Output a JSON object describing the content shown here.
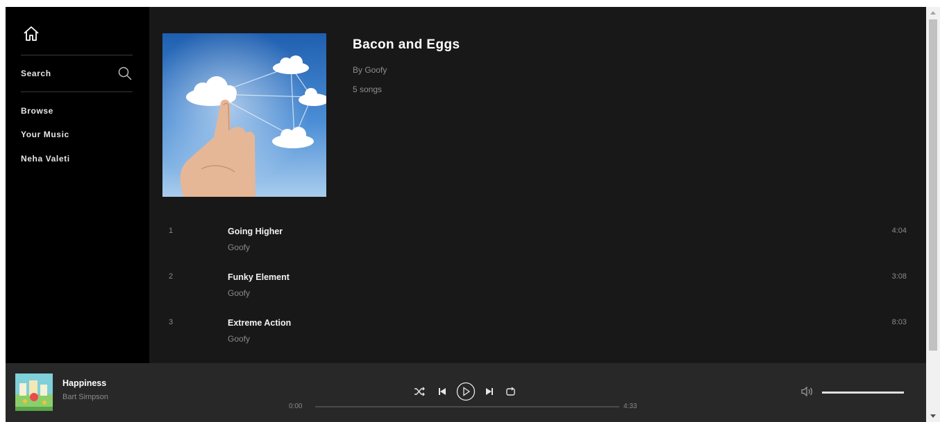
{
  "sidebar": {
    "search_label": "Search",
    "items": [
      {
        "label": "Browse"
      },
      {
        "label": "Your Music"
      },
      {
        "label": "Neha Valeti"
      }
    ]
  },
  "album": {
    "title": "Bacon and Eggs",
    "artist": "By Goofy",
    "song_count": "5 songs",
    "art_icon": "cloud-touch-artwork"
  },
  "tracks": [
    {
      "num": "1",
      "title": "Going Higher",
      "artist": "Goofy",
      "duration": "4:04"
    },
    {
      "num": "2",
      "title": "Funky Element",
      "artist": "Goofy",
      "duration": "3:08"
    },
    {
      "num": "3",
      "title": "Extreme Action",
      "artist": "Goofy",
      "duration": "8:03"
    }
  ],
  "player": {
    "now_title": "Happiness",
    "now_artist": "Bart Simpson",
    "time_current": "0:00",
    "time_total": "4:33",
    "progress": 0,
    "volume": 1.0
  },
  "colors": {
    "sidebar_bg": "#000000",
    "main_bg": "#181818",
    "player_bg": "#282828",
    "text_primary": "#ffffff",
    "text_muted": "#8a8a8a"
  },
  "icons": {
    "home": "home-icon",
    "search": "search-icon",
    "shuffle": "shuffle-icon",
    "previous": "previous-icon",
    "play": "play-icon",
    "next": "next-icon",
    "repeat": "repeat-icon",
    "volume": "volume-icon"
  }
}
